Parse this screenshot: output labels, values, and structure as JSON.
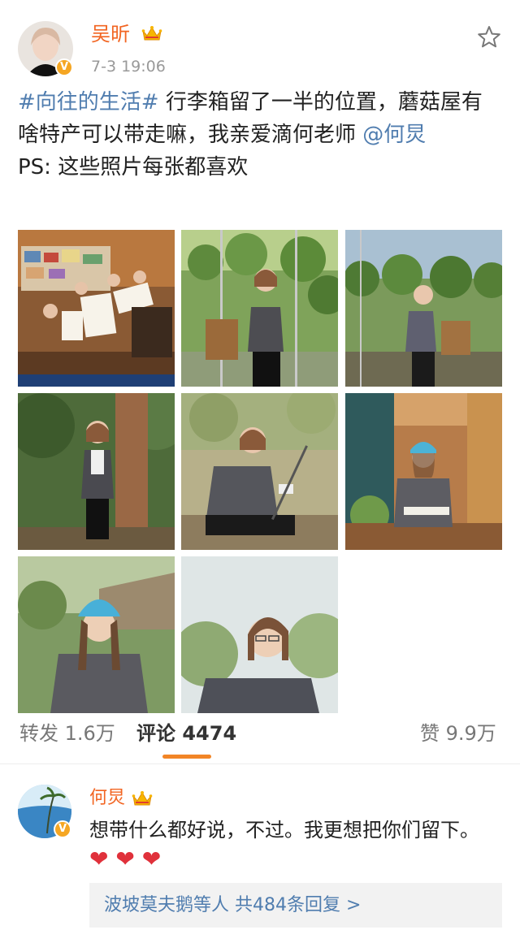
{
  "post": {
    "author": {
      "name": "吴昕",
      "verified_badge": "V"
    },
    "timestamp": "7-3 19:06",
    "text": {
      "hashtag": "#向往的生活#",
      "body": " 行李箱留了一半的位置，蘑菇屋有啥特产可以带走嘛，我亲爱滴何老师 ",
      "mention": "@何炅",
      "ps": "PS: 这些照片每张都喜欢"
    },
    "photo_count": 8
  },
  "stats": {
    "repost_label": "转发",
    "repost_count": "1.6万",
    "comment_label": "评论",
    "comment_count": "4474",
    "like_label": "赞",
    "like_count": "9.9万"
  },
  "comment": {
    "author": {
      "name": "何炅",
      "verified_badge": "V"
    },
    "text": "想带什么都好说，不过。我更想把你们留下。",
    "hearts": "❤ ❤ ❤",
    "reply_summary": "波坡莫夫鹅等人 共484条回复 >"
  },
  "colors": {
    "username": "#f26522",
    "link": "#507daf",
    "accent_underline": "#f28526",
    "heart": "#e0313b"
  },
  "icons": {
    "favorite": "star-icon",
    "vip": "crown-icon",
    "verified": "verified-badge-icon"
  }
}
